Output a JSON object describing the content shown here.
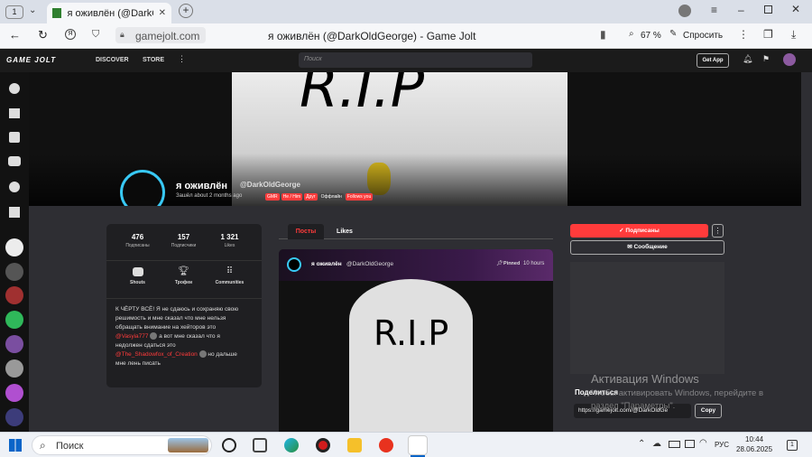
{
  "browser": {
    "tab_count": "1",
    "tab_title": "я оживлён (@DarkOldGe",
    "url": "gamejolt.com",
    "page_title": "я оживлён (@DarkOldGeorge) - Game Jolt",
    "zoom": "67 %",
    "ask_label": "Спросить"
  },
  "gj": {
    "logo": "GAME JOLT",
    "discover": "DISCOVER",
    "store": "STORE",
    "search_placeholder": "Поиск",
    "get_app": "Get App",
    "banner_text": "R.I.P",
    "profile": {
      "name": "я оживлён",
      "handle": "@DarkOldGeorge",
      "joined": "Зашёл about 2 months ago",
      "tags": [
        {
          "label": "GMR",
          "color": "#ff3b3b"
        },
        {
          "label": "He / Him",
          "color": "#ff3b3b"
        },
        {
          "label": "Друг",
          "color": "#ff3b3b"
        },
        {
          "label": "Оффлайн",
          "color": "#444444"
        },
        {
          "label": "Follows you",
          "color": "#ff3b3b"
        }
      ]
    },
    "stats": [
      {
        "value": "476",
        "label": "Подписаны"
      },
      {
        "value": "157",
        "label": "Подписчики"
      },
      {
        "value": "1 321",
        "label": "Likes"
      }
    ],
    "sections": [
      "Shouts",
      "Трофеи",
      "Communities"
    ],
    "bio": {
      "line1": "К ЧЁРТУ ВСЁ! Я не сдаюсь и сохраняю свою",
      "line2": "решимость и мне сказал что мне нельзя",
      "line3": "обращать внимание на хейторов это",
      "mention1": "@Vasyia777",
      "line4": "а вот мне сказал что я",
      "line5": "недолжен сдаться это",
      "mention2": "@The_Shadowfox_of_Creation",
      "line6": "но дальше",
      "line7": "мне лень писать"
    },
    "tabs": [
      "Посты",
      "Likes"
    ],
    "post": {
      "author": "я оживлён",
      "handle": "@DarkOldGeorge",
      "pinned": "Pinned",
      "time": "10 hours",
      "image_text": "R.I.P"
    },
    "follow_label": "Подписаны",
    "message_label": "Сообщение",
    "share_title": "Поделиться",
    "share_url": "https://gamejolt.com/@DarkOldGe",
    "copy_label": "Copy",
    "watermark_title": "Активация Windows",
    "watermark_sub1": "Чтобы активировать Windows, перейдите в",
    "watermark_sub2": "раздел \"Параметры\"."
  },
  "taskbar": {
    "search": "Поиск",
    "lang": "РУС",
    "time": "10:44",
    "date": "28.06.2025",
    "notif_count": "1"
  }
}
